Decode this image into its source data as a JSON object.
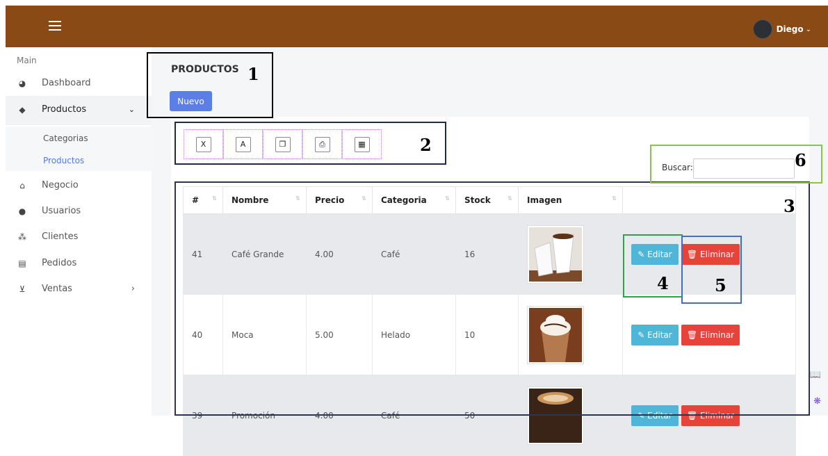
{
  "header": {
    "user_name": "Diego",
    "user_caret": "⌄"
  },
  "sidebar": {
    "section": "Main",
    "items": [
      {
        "label": "Dashboard",
        "icon": "◕",
        "chev": ""
      },
      {
        "label": "Productos",
        "icon": "◆",
        "chev": "⌄"
      },
      {
        "label": "Negocio",
        "icon": "⌂",
        "chev": ""
      },
      {
        "label": "Usuarios",
        "icon": "●",
        "chev": ""
      },
      {
        "label": "Clientes",
        "icon": "⁂",
        "chev": ""
      },
      {
        "label": "Pedidos",
        "icon": "▤",
        "chev": ""
      },
      {
        "label": "Ventas",
        "icon": "⊻",
        "chev": "›"
      }
    ],
    "subitems": [
      {
        "label": "Categorias"
      },
      {
        "label": "Productos"
      }
    ]
  },
  "page": {
    "title": "PRODUCTOS",
    "new_button": "Nuevo"
  },
  "toolbar": {
    "excel": "X",
    "pdf": "A",
    "copy": "❐",
    "print": "⎙",
    "csv": "▦"
  },
  "search": {
    "label": "Buscar:",
    "value": ""
  },
  "table": {
    "headers": [
      "#",
      "Nombre",
      "Precio",
      "Categoria",
      "Stock",
      "Imagen",
      ""
    ],
    "sort_glyph": "⇅",
    "edit_label": "✎ Editar",
    "delete_label": "🗑 Eliminar",
    "rows": [
      {
        "id": "41",
        "name": "Café Grande",
        "price": "4.00",
        "category": "Café",
        "stock": "16"
      },
      {
        "id": "40",
        "name": "Moca",
        "price": "5.00",
        "category": "Helado",
        "stock": "10"
      },
      {
        "id": "39",
        "name": "Promoción",
        "price": "4.00",
        "category": "Café",
        "stock": "50"
      }
    ]
  },
  "annotations": [
    "1",
    "2",
    "3",
    "4",
    "5",
    "6"
  ],
  "floating": {
    "book": "📖",
    "brain": "❋"
  }
}
